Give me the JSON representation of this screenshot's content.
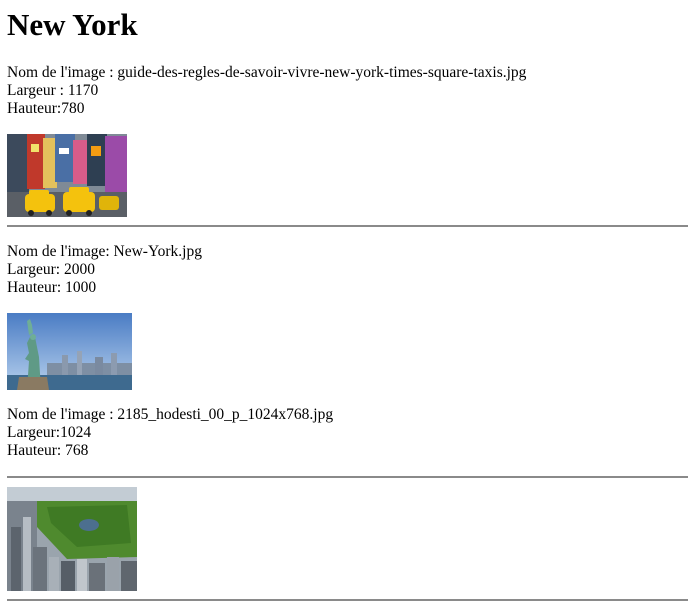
{
  "page": {
    "title": "New York"
  },
  "images": [
    {
      "name_line": "Nom de l'image : guide-des-regles-de-savoir-vivre-new-york-times-square-taxis.jpg",
      "width_line": "Largeur : 1170",
      "height_line": "Hauteur:780",
      "thumb_alt": "Times Square taxis"
    },
    {
      "name_line": "Nom de l'image: New-York.jpg",
      "width_line": "Largeur: 2000",
      "height_line": "Hauteur: 1000",
      "thumb_alt": "Statue of Liberty"
    },
    {
      "name_line": "Nom de l'image : 2185_hodesti_00_p_1024x768.jpg",
      "width_line": "Largeur:1024",
      "height_line": "Hauteur: 768",
      "thumb_alt": "Central Park aerial view"
    }
  ]
}
